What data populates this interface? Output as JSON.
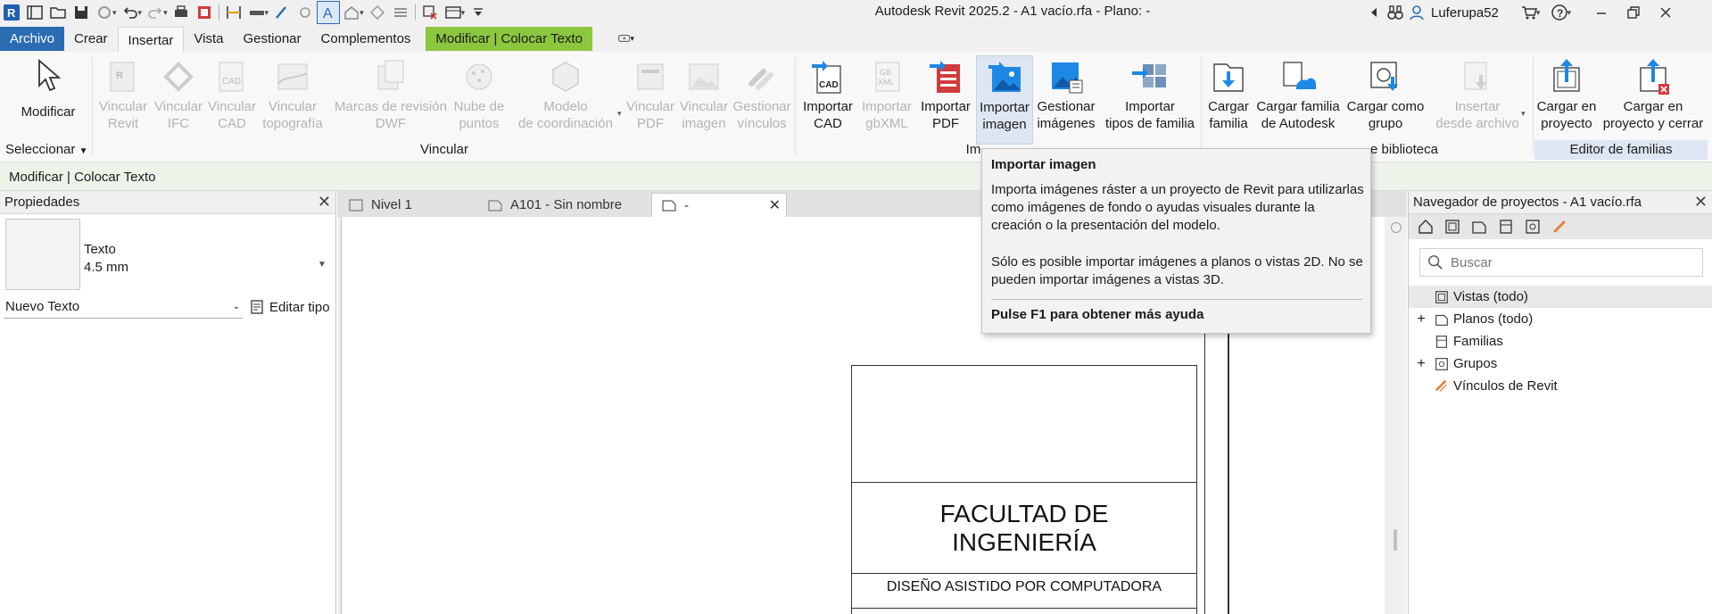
{
  "app": {
    "title": "Autodesk Revit 2025.2 - A1 vacío.rfa - Plano:  -",
    "user": "Luferupa52"
  },
  "menu": {
    "tabs": [
      "Archivo",
      "Crear",
      "Insertar",
      "Vista",
      "Gestionar",
      "Complementos",
      "Modificar | Colocar Texto"
    ]
  },
  "ribbon": {
    "modify": "Modificar",
    "select_panel": "Seleccionar",
    "link_panel": "Vincular",
    "import_panel_partial": "Im",
    "library_panel_partial": "e biblioteca",
    "family_editor_panel": "Editor de familias",
    "buttons": {
      "vincular_revit": [
        "Vincular",
        "Revit"
      ],
      "vincular_ifc": [
        "Vincular",
        "IFC"
      ],
      "vincular_cad": [
        "Vincular",
        "CAD"
      ],
      "vincular_topografia": [
        "Vincular",
        "topografía"
      ],
      "marcas_revision": [
        "Marcas de revisión",
        "DWF"
      ],
      "nube_puntos": [
        "Nube de",
        "puntos"
      ],
      "modelo_coordinacion": [
        "Modelo",
        "de coordinación"
      ],
      "vincular_pdf": [
        "Vincular",
        "PDF"
      ],
      "vincular_imagen": [
        "Vincular",
        "imagen"
      ],
      "gestionar_vinculos": [
        "Gestionar",
        "vínculos"
      ],
      "importar_cad": [
        "Importar",
        "CAD"
      ],
      "importar_gbxml": [
        "Importar",
        "gbXML"
      ],
      "importar_pdf": [
        "Importar",
        "PDF"
      ],
      "importar_imagen": [
        "Importar",
        "imagen"
      ],
      "gestionar_imagenes": [
        "Gestionar",
        "imágenes"
      ],
      "importar_tipos_familia": [
        "Importar",
        "tipos de familia"
      ],
      "cargar_familia": [
        "Cargar",
        "familia"
      ],
      "cargar_familia_autodesk": [
        "Cargar familia",
        "de Autodesk"
      ],
      "cargar_como_grupo": [
        "Cargar como",
        "grupo"
      ],
      "insertar_desde_archivo": [
        "Insertar",
        "desde archivo"
      ],
      "cargar_en_proyecto": [
        "Cargar en",
        "proyecto"
      ],
      "cargar_en_proyecto_cerrar": [
        "Cargar en",
        "proyecto y cerrar"
      ]
    }
  },
  "context_bar": {
    "label": "Modificar | Colocar Texto"
  },
  "properties": {
    "title": "Propiedades",
    "type_name": "Texto",
    "type_size": "4.5 mm",
    "instance": "Nuevo Texto",
    "edit_type": "Editar tipo"
  },
  "view_tabs": [
    {
      "label": "Nivel 1"
    },
    {
      "label": "A101 - Sin nombre"
    },
    {
      "label": "-"
    }
  ],
  "sheet": {
    "faculty_line1": "FACULTAD DE",
    "faculty_line2": "INGENIERÍA",
    "course": "DISEÑO ASISTIDO POR COMPUTADORA"
  },
  "tooltip": {
    "title": "Importar imagen",
    "body1": "Importa imágenes ráster a un proyecto de Revit para utilizarlas como imágenes de fondo o ayudas visuales durante la creación o la presentación del modelo.",
    "body2": "Sólo es posible importar imágenes a planos o vistas 2D. No se pueden importar imágenes a vistas 3D.",
    "help": "Pulse F1 para obtener más ayuda"
  },
  "browser": {
    "title": "Navegador de proyectos - A1 vacío.rfa",
    "search_placeholder": "Buscar",
    "items": [
      {
        "label": "Vistas (todo)",
        "icon": "views-icon",
        "expand": ""
      },
      {
        "label": "Planos (todo)",
        "icon": "sheets-icon",
        "expand": "+"
      },
      {
        "label": "Familias",
        "icon": "families-icon",
        "expand": ""
      },
      {
        "label": "Grupos",
        "icon": "groups-icon",
        "expand": "+"
      },
      {
        "label": "Vínculos de Revit",
        "icon": "revit-links-icon",
        "expand": ""
      }
    ]
  },
  "colors": {
    "accent": "#2b6cb3",
    "context_tab": "#8cc63f",
    "import_blue": "#1e88e5",
    "link_orange": "#e8803a"
  }
}
